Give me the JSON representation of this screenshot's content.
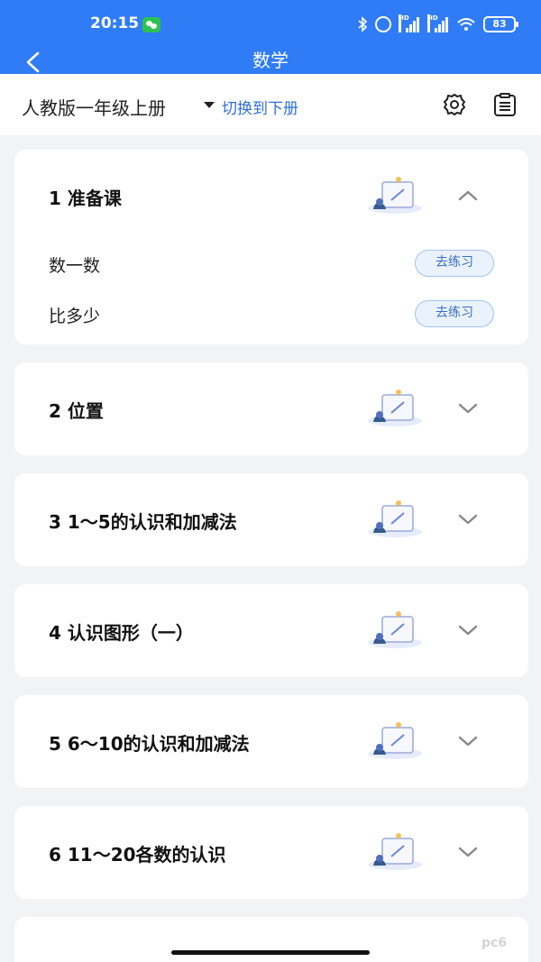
{
  "status": {
    "time": "20:15",
    "battery": "83",
    "hd1": "HD",
    "hd2": "HD"
  },
  "nav": {
    "title": "数学"
  },
  "toolbar": {
    "edition": "人教版一年级上册",
    "switch": "切换到下册"
  },
  "chapters": [
    {
      "title": "1 准备课",
      "expanded": true,
      "lessons": [
        {
          "name": "数一数",
          "action": "去练习"
        },
        {
          "name": "比多少",
          "action": "去练习"
        }
      ]
    },
    {
      "title": "2 位置",
      "expanded": false
    },
    {
      "title": "3 1～5的认识和加减法",
      "expanded": false
    },
    {
      "title": "4 认识图形（一）",
      "expanded": false
    },
    {
      "title": "5 6～10的认识和加减法",
      "expanded": false
    },
    {
      "title": "6 11～20各数的认识",
      "expanded": false
    }
  ],
  "watermark": "pc6"
}
